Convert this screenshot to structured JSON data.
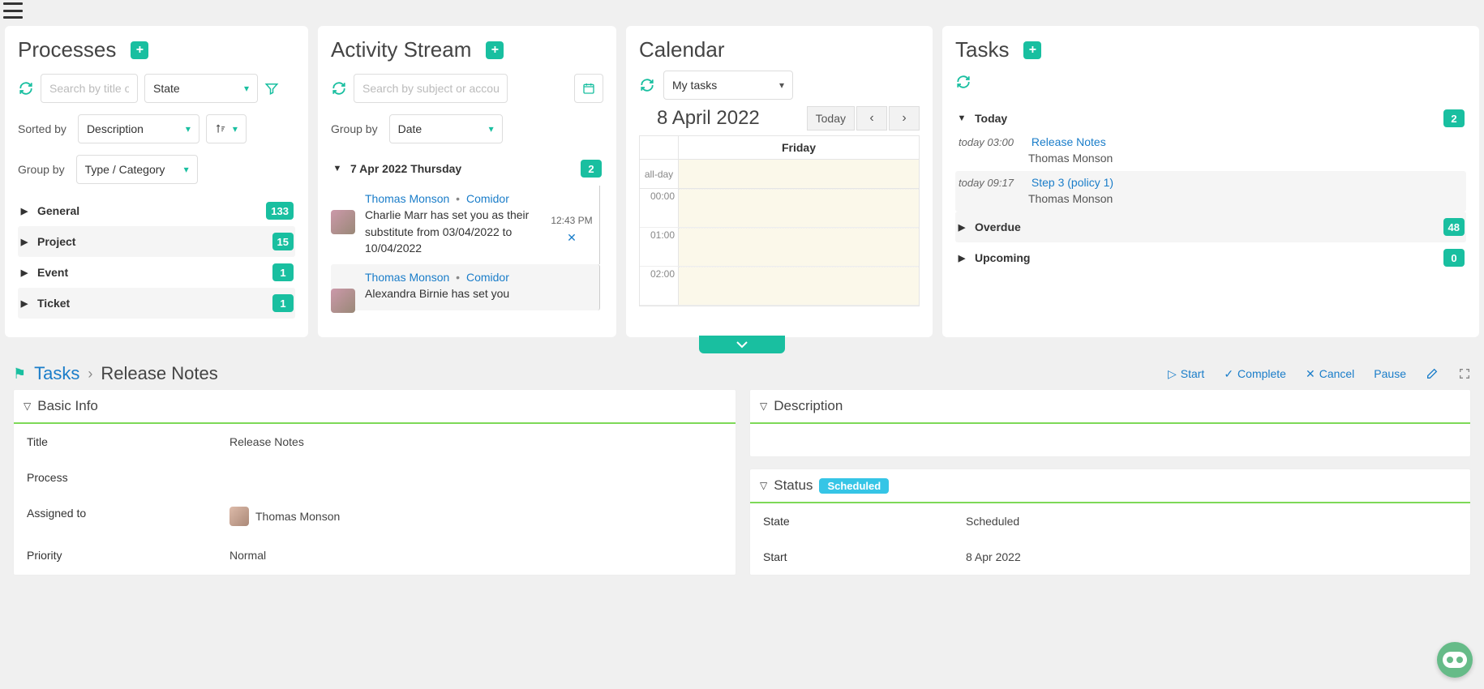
{
  "processes": {
    "title": "Processes",
    "search_placeholder": "Search by title or a",
    "state_select": "State",
    "sorted_by_label": "Sorted by",
    "sorted_by_value": "Description",
    "group_by_label": "Group by",
    "group_by_value": "Type / Category",
    "groups": [
      {
        "name": "General",
        "count": "133"
      },
      {
        "name": "Project",
        "count": "15"
      },
      {
        "name": "Event",
        "count": "1"
      },
      {
        "name": "Ticket",
        "count": "1"
      }
    ]
  },
  "activity": {
    "title": "Activity Stream",
    "search_placeholder": "Search by subject or accoun",
    "group_by_label": "Group by",
    "group_by_value": "Date",
    "day_header": "7 Apr 2022 Thursday",
    "day_count": "2",
    "items": [
      {
        "user": "Thomas Monson",
        "org": "Comidor",
        "text": "Charlie Marr has set you as their substitute from 03/04/2022 to 10/04/2022",
        "time": "12:43 PM"
      },
      {
        "user": "Thomas Monson",
        "org": "Comidor",
        "text": "Alexandra Birnie has set you",
        "time": ""
      }
    ]
  },
  "calendar": {
    "title": "Calendar",
    "scope": "My tasks",
    "date": "8 April 2022",
    "today_label": "Today",
    "day_name": "Friday",
    "allday_label": "all-day",
    "slots": [
      "00:00",
      "01:00",
      "02:00"
    ]
  },
  "tasks_panel": {
    "title": "Tasks",
    "today_label": "Today",
    "today_count": "2",
    "today_items": [
      {
        "time": "today 03:00",
        "title": "Release Notes",
        "sub": "Thomas Monson"
      },
      {
        "time": "today 09:17",
        "title": "Step 3 (policy 1)",
        "sub": "Thomas Monson"
      }
    ],
    "overdue_label": "Overdue",
    "overdue_count": "48",
    "upcoming_label": "Upcoming",
    "upcoming_count": "0"
  },
  "detail": {
    "crumb_root": "Tasks",
    "crumb_leaf": "Release Notes",
    "actions": {
      "start": "Start",
      "complete": "Complete",
      "cancel": "Cancel",
      "pause": "Pause"
    },
    "basic_info": {
      "header": "Basic Info",
      "title_label": "Title",
      "title_value": "Release Notes",
      "process_label": "Process",
      "process_value": "",
      "assigned_label": "Assigned to",
      "assigned_value": "Thomas Monson",
      "priority_label": "Priority",
      "priority_value": "Normal"
    },
    "description": {
      "header": "Description"
    },
    "status": {
      "header": "Status",
      "badge": "Scheduled",
      "state_label": "State",
      "state_value": "Scheduled",
      "start_label": "Start",
      "start_value": "8 Apr 2022"
    }
  }
}
